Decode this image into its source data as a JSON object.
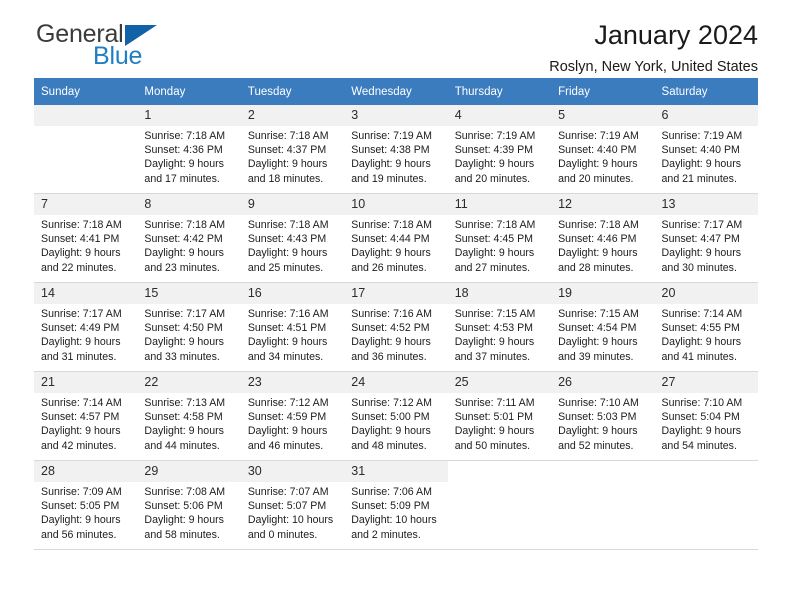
{
  "brand": {
    "name_part1": "General",
    "name_part2": "Blue",
    "triangle_color": "#1262a8",
    "blue_color": "#1f7fc4"
  },
  "header": {
    "title": "January 2024",
    "location": "Roslyn, New York, United States"
  },
  "theme": {
    "header_blue": "#3b7cbf",
    "day_band_gray": "#f1f1f1",
    "grid_line": "#d8d8d8"
  },
  "weekdays": [
    "Sunday",
    "Monday",
    "Tuesday",
    "Wednesday",
    "Thursday",
    "Friday",
    "Saturday"
  ],
  "weeks": [
    [
      {
        "day": "",
        "lines": []
      },
      {
        "day": "1",
        "lines": [
          "Sunrise: 7:18 AM",
          "Sunset: 4:36 PM",
          "Daylight: 9 hours",
          "and 17 minutes."
        ]
      },
      {
        "day": "2",
        "lines": [
          "Sunrise: 7:18 AM",
          "Sunset: 4:37 PM",
          "Daylight: 9 hours",
          "and 18 minutes."
        ]
      },
      {
        "day": "3",
        "lines": [
          "Sunrise: 7:19 AM",
          "Sunset: 4:38 PM",
          "Daylight: 9 hours",
          "and 19 minutes."
        ]
      },
      {
        "day": "4",
        "lines": [
          "Sunrise: 7:19 AM",
          "Sunset: 4:39 PM",
          "Daylight: 9 hours",
          "and 20 minutes."
        ]
      },
      {
        "day": "5",
        "lines": [
          "Sunrise: 7:19 AM",
          "Sunset: 4:40 PM",
          "Daylight: 9 hours",
          "and 20 minutes."
        ]
      },
      {
        "day": "6",
        "lines": [
          "Sunrise: 7:19 AM",
          "Sunset: 4:40 PM",
          "Daylight: 9 hours",
          "and 21 minutes."
        ]
      }
    ],
    [
      {
        "day": "7",
        "lines": [
          "Sunrise: 7:18 AM",
          "Sunset: 4:41 PM",
          "Daylight: 9 hours",
          "and 22 minutes."
        ]
      },
      {
        "day": "8",
        "lines": [
          "Sunrise: 7:18 AM",
          "Sunset: 4:42 PM",
          "Daylight: 9 hours",
          "and 23 minutes."
        ]
      },
      {
        "day": "9",
        "lines": [
          "Sunrise: 7:18 AM",
          "Sunset: 4:43 PM",
          "Daylight: 9 hours",
          "and 25 minutes."
        ]
      },
      {
        "day": "10",
        "lines": [
          "Sunrise: 7:18 AM",
          "Sunset: 4:44 PM",
          "Daylight: 9 hours",
          "and 26 minutes."
        ]
      },
      {
        "day": "11",
        "lines": [
          "Sunrise: 7:18 AM",
          "Sunset: 4:45 PM",
          "Daylight: 9 hours",
          "and 27 minutes."
        ]
      },
      {
        "day": "12",
        "lines": [
          "Sunrise: 7:18 AM",
          "Sunset: 4:46 PM",
          "Daylight: 9 hours",
          "and 28 minutes."
        ]
      },
      {
        "day": "13",
        "lines": [
          "Sunrise: 7:17 AM",
          "Sunset: 4:47 PM",
          "Daylight: 9 hours",
          "and 30 minutes."
        ]
      }
    ],
    [
      {
        "day": "14",
        "lines": [
          "Sunrise: 7:17 AM",
          "Sunset: 4:49 PM",
          "Daylight: 9 hours",
          "and 31 minutes."
        ]
      },
      {
        "day": "15",
        "lines": [
          "Sunrise: 7:17 AM",
          "Sunset: 4:50 PM",
          "Daylight: 9 hours",
          "and 33 minutes."
        ]
      },
      {
        "day": "16",
        "lines": [
          "Sunrise: 7:16 AM",
          "Sunset: 4:51 PM",
          "Daylight: 9 hours",
          "and 34 minutes."
        ]
      },
      {
        "day": "17",
        "lines": [
          "Sunrise: 7:16 AM",
          "Sunset: 4:52 PM",
          "Daylight: 9 hours",
          "and 36 minutes."
        ]
      },
      {
        "day": "18",
        "lines": [
          "Sunrise: 7:15 AM",
          "Sunset: 4:53 PM",
          "Daylight: 9 hours",
          "and 37 minutes."
        ]
      },
      {
        "day": "19",
        "lines": [
          "Sunrise: 7:15 AM",
          "Sunset: 4:54 PM",
          "Daylight: 9 hours",
          "and 39 minutes."
        ]
      },
      {
        "day": "20",
        "lines": [
          "Sunrise: 7:14 AM",
          "Sunset: 4:55 PM",
          "Daylight: 9 hours",
          "and 41 minutes."
        ]
      }
    ],
    [
      {
        "day": "21",
        "lines": [
          "Sunrise: 7:14 AM",
          "Sunset: 4:57 PM",
          "Daylight: 9 hours",
          "and 42 minutes."
        ]
      },
      {
        "day": "22",
        "lines": [
          "Sunrise: 7:13 AM",
          "Sunset: 4:58 PM",
          "Daylight: 9 hours",
          "and 44 minutes."
        ]
      },
      {
        "day": "23",
        "lines": [
          "Sunrise: 7:12 AM",
          "Sunset: 4:59 PM",
          "Daylight: 9 hours",
          "and 46 minutes."
        ]
      },
      {
        "day": "24",
        "lines": [
          "Sunrise: 7:12 AM",
          "Sunset: 5:00 PM",
          "Daylight: 9 hours",
          "and 48 minutes."
        ]
      },
      {
        "day": "25",
        "lines": [
          "Sunrise: 7:11 AM",
          "Sunset: 5:01 PM",
          "Daylight: 9 hours",
          "and 50 minutes."
        ]
      },
      {
        "day": "26",
        "lines": [
          "Sunrise: 7:10 AM",
          "Sunset: 5:03 PM",
          "Daylight: 9 hours",
          "and 52 minutes."
        ]
      },
      {
        "day": "27",
        "lines": [
          "Sunrise: 7:10 AM",
          "Sunset: 5:04 PM",
          "Daylight: 9 hours",
          "and 54 minutes."
        ]
      }
    ],
    [
      {
        "day": "28",
        "lines": [
          "Sunrise: 7:09 AM",
          "Sunset: 5:05 PM",
          "Daylight: 9 hours",
          "and 56 minutes."
        ]
      },
      {
        "day": "29",
        "lines": [
          "Sunrise: 7:08 AM",
          "Sunset: 5:06 PM",
          "Daylight: 9 hours",
          "and 58 minutes."
        ]
      },
      {
        "day": "30",
        "lines": [
          "Sunrise: 7:07 AM",
          "Sunset: 5:07 PM",
          "Daylight: 10 hours",
          "and 0 minutes."
        ]
      },
      {
        "day": "31",
        "lines": [
          "Sunrise: 7:06 AM",
          "Sunset: 5:09 PM",
          "Daylight: 10 hours",
          "and 2 minutes."
        ]
      },
      {
        "day": "",
        "lines": [],
        "blank": true
      },
      {
        "day": "",
        "lines": [],
        "blank": true
      },
      {
        "day": "",
        "lines": [],
        "blank": true
      }
    ]
  ]
}
